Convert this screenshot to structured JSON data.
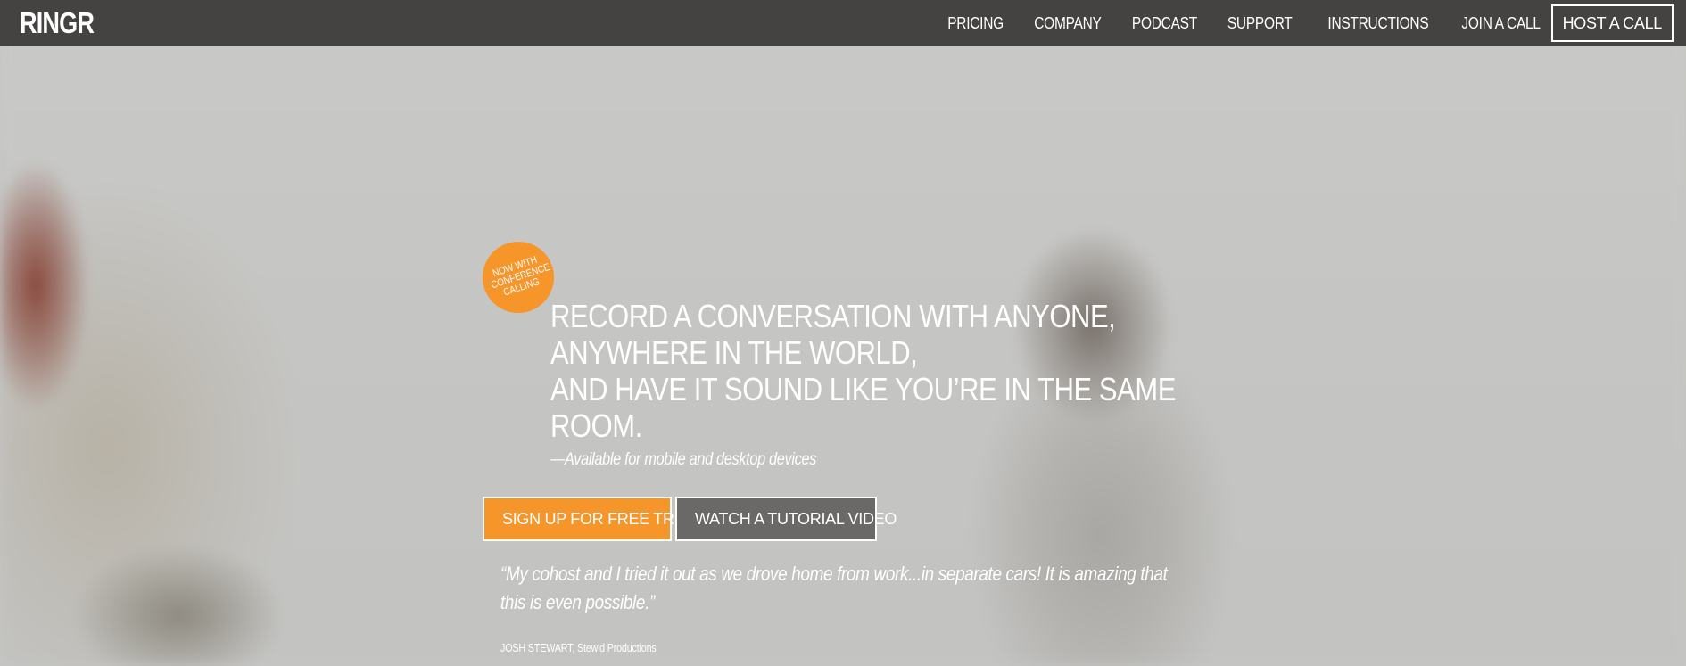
{
  "brand": {
    "logo_text": "RINGR"
  },
  "nav": {
    "items": [
      {
        "label": "PRICING"
      },
      {
        "label": "COMPANY"
      },
      {
        "label": "PODCAST"
      },
      {
        "label": "SUPPORT"
      },
      {
        "label": "INSTRUCTIONS"
      },
      {
        "label": "JOIN A CALL"
      }
    ],
    "host_label": "HOST A CALL"
  },
  "hero": {
    "badge_lines": [
      "NOW WITH",
      "CONFERENCE",
      "CALLING"
    ],
    "headline_lines": [
      "RECORD A CONVERSATION WITH ANYONE,",
      "ANYWHERE IN THE WORLD,",
      "AND HAVE IT SOUND LIKE YOU’RE IN THE SAME",
      "ROOM."
    ],
    "subtext": "—Available for mobile and desktop devices",
    "primary_button": "SIGN UP FOR FREE TRIAL",
    "secondary_button": "WATCH A TUTORIAL VIDEO",
    "quote_lines": [
      "“My cohost and I tried it out as we drove home from work...in separate cars! It is amazing that",
      "this is even possible.”"
    ],
    "attribution": "JOSH STEWART, Stew'd Productions"
  },
  "colors": {
    "nav_background": "#454341",
    "accent_orange": "#f6952a",
    "secondary_button_gray": "#6b6968"
  }
}
